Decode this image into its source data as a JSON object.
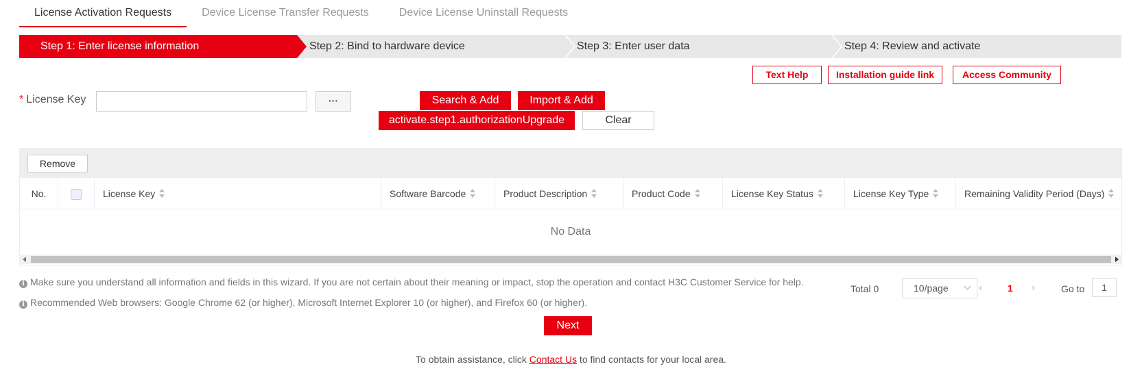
{
  "tabs": [
    {
      "label": "License Activation Requests",
      "active": true
    },
    {
      "label": "Device License Transfer Requests",
      "active": false
    },
    {
      "label": "Device License Uninstall Requests",
      "active": false
    }
  ],
  "steps": [
    {
      "label": "Step 1: Enter license information",
      "active": true
    },
    {
      "label": "Step 2: Bind to hardware device",
      "active": false
    },
    {
      "label": "Step 3: Enter user data",
      "active": false
    },
    {
      "label": "Step 4: Review and activate",
      "active": false
    }
  ],
  "help_links": {
    "text_help": "Text Help",
    "installation_guide": "Installation guide link",
    "access_community": "Access Community"
  },
  "license_form": {
    "required_mark": "*",
    "label": "License Key",
    "value": "",
    "more_button": "···",
    "search_add": "Search & Add",
    "import_add": "Import & Add",
    "authorization_upgrade": "activate.step1.authorizationUpgrade",
    "clear": "Clear"
  },
  "table": {
    "remove_button": "Remove",
    "columns": [
      "No.",
      "",
      "License Key",
      "Software Barcode",
      "Product Description",
      "Product Code",
      "License Key Status",
      "License Key Type",
      "Remaining Validity Period (Days)"
    ],
    "rows": [],
    "empty_text": "No Data"
  },
  "notes": [
    "Make sure you understand all information and fields in this wizard. If you are not certain about their meaning or impact, stop the operation and contact H3C Customer Service for help.",
    "Recommended Web browsers: Google Chrome 62 (or higher), Microsoft Internet Explorer 10 (or higher), and Firefox 60 (or higher)."
  ],
  "pagination": {
    "total_label": "Total 0",
    "page_size": "10/page",
    "current_page": "1",
    "goto_label": "Go to",
    "goto_value": "1"
  },
  "next_button": "Next",
  "footer": {
    "before": "To obtain assistance, click ",
    "link": "Contact Us",
    "after": " to find contacts for your local area."
  },
  "colors": {
    "accent": "#e60012",
    "step_bg": "#e8e8e8"
  }
}
